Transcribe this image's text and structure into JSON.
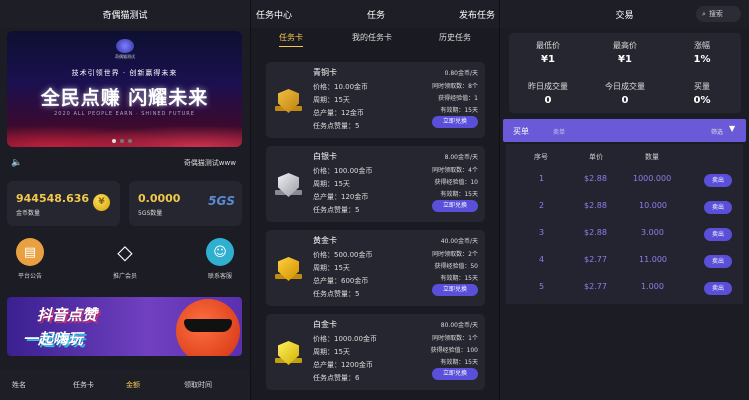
{
  "panel1": {
    "title": "奇偶猫测试",
    "banner": {
      "logo_text": "奇偶猫测试",
      "slogan_top": "技术引领世界 · 创新赢得未来",
      "slogan_main": "全民点赚  闪耀未来",
      "slogan_sub": "2020 ALL PEOPLE EARN · SHINED FUTURE"
    },
    "notice": {
      "icon": "speaker-icon",
      "text": "奇偶猫测试www"
    },
    "stats": [
      {
        "value": "944548.636",
        "label": "金币数量",
        "icon": "coin-icon"
      },
      {
        "value": "0.0000",
        "label": "5GS数量",
        "icon": "5gs-icon",
        "icon_text": "5GS"
      }
    ],
    "quick_links": [
      {
        "label": "平台公告",
        "icon": "announcement-icon"
      },
      {
        "label": "推广会员",
        "icon": "diamond-icon"
      },
      {
        "label": "联系客服",
        "icon": "customer-service-icon"
      }
    ],
    "promo": {
      "line1": "抖音点赞",
      "line2": "一起嗨玩"
    },
    "table_header": [
      "姓名",
      "任务卡",
      "金额",
      "领取时间"
    ]
  },
  "panel2": {
    "header": {
      "left": "任务中心",
      "center": "任务",
      "right": "发布任务"
    },
    "subtabs": [
      "任务卡",
      "我的任务卡",
      "历史任务"
    ],
    "cards": [
      {
        "name": "青铜卡",
        "price_label": "价格：",
        "price": "10.00金币",
        "cycle_label": "周期：",
        "cycle": "15天",
        "total_label": "总产量：",
        "total": "12金币",
        "likes_label": "任务点赞量：",
        "likes": "5",
        "rate": "0.80金币/天",
        "claims_label": "同时领取数：",
        "claims": "8个",
        "exp_label": "获得经验值：",
        "exp": "1",
        "valid_label": "有效期：",
        "valid": "15天",
        "button": "立即兑换",
        "color": "#e0a020"
      },
      {
        "name": "白银卡",
        "price_label": "价格：",
        "price": "100.00金币",
        "cycle_label": "周期：",
        "cycle": "15天",
        "total_label": "总产量：",
        "total": "120金币",
        "likes_label": "任务点赞量：",
        "likes": "5",
        "rate": "8.00金币/天",
        "claims_label": "同时领取数：",
        "claims": "4个",
        "exp_label": "获得经验值：",
        "exp": "10",
        "valid_label": "有效期：",
        "valid": "15天",
        "button": "立即兑换",
        "color": "#c8c8d0"
      },
      {
        "name": "黄金卡",
        "price_label": "价格：",
        "price": "500.00金币",
        "cycle_label": "周期：",
        "cycle": "15天",
        "total_label": "总产量：",
        "total": "600金币",
        "likes_label": "任务点赞量：",
        "likes": "5",
        "rate": "40.00金币/天",
        "claims_label": "同时领取数：",
        "claims": "2个",
        "exp_label": "获得经验值：",
        "exp": "50",
        "valid_label": "有效期：",
        "valid": "15天",
        "button": "立即兑换",
        "color": "#f0b020"
      },
      {
        "name": "白金卡",
        "price_label": "价格：",
        "price": "1000.00金币",
        "cycle_label": "周期：",
        "cycle": "15天",
        "total_label": "总产量：",
        "total": "1200金币",
        "likes_label": "任务点赞量：",
        "likes": "6",
        "rate": "80.00金币/天",
        "claims_label": "同时领取数：",
        "claims": "1个",
        "exp_label": "获得经验值：",
        "exp": "100",
        "valid_label": "有效期：",
        "valid": "15天",
        "button": "立即兑换",
        "color": "#f0d030"
      }
    ]
  },
  "panel3": {
    "title": "交易",
    "search": "搜索",
    "market": [
      {
        "label": "最低价",
        "value": "¥1"
      },
      {
        "label": "最高价",
        "value": "¥1"
      },
      {
        "label": "涨幅",
        "value": "1%"
      },
      {
        "label": "昨日成交量",
        "value": "0"
      },
      {
        "label": "今日成交量",
        "value": "0"
      },
      {
        "label": "买量",
        "value": "0%"
      }
    ],
    "buybar": {
      "tab": "买单",
      "sub": "卖单",
      "filter": "筛选"
    },
    "order_header": [
      "序号",
      "单价",
      "数量"
    ],
    "orders": [
      {
        "no": "1",
        "price": "$2.88",
        "qty": "1000.000",
        "action": "卖出"
      },
      {
        "no": "2",
        "price": "$2.88",
        "qty": "10.000",
        "action": "卖出"
      },
      {
        "no": "3",
        "price": "$2.88",
        "qty": "3.000",
        "action": "卖出"
      },
      {
        "no": "4",
        "price": "$2.77",
        "qty": "11.000",
        "action": "卖出"
      },
      {
        "no": "5",
        "price": "$2.77",
        "qty": "1.000",
        "action": "卖出"
      }
    ]
  }
}
